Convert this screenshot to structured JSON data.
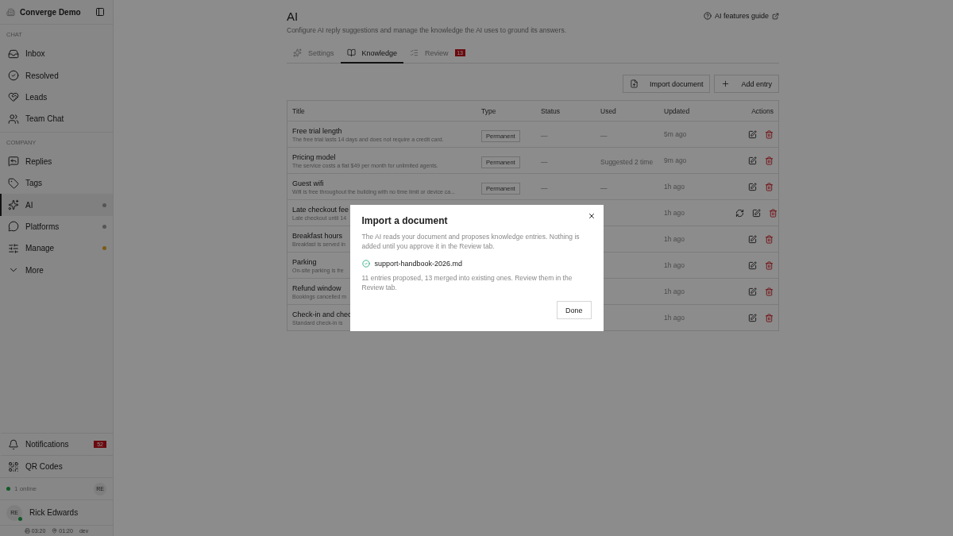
{
  "workspace": {
    "name": "Converge Demo"
  },
  "sidebar": {
    "sections": [
      {
        "heading": "CHAT",
        "items": [
          {
            "label": "Inbox",
            "selected": false
          },
          {
            "label": "Resolved",
            "selected": false
          },
          {
            "label": "Leads",
            "selected": false
          },
          {
            "label": "Team Chat",
            "selected": false
          }
        ]
      },
      {
        "heading": "COMPANY",
        "items": [
          {
            "label": "Replies",
            "selected": false
          },
          {
            "label": "Tags",
            "selected": false
          },
          {
            "label": "AI",
            "selected": true,
            "color": "#555555"
          },
          {
            "label": "Platforms",
            "selected": false,
            "color": "#555555"
          },
          {
            "label": "Manage",
            "selected": false,
            "color": "#7b5b15"
          },
          {
            "label": "More",
            "selected": false
          }
        ]
      }
    ],
    "bottom": [
      {
        "label": "Notifications",
        "badge": "52"
      },
      {
        "label": "QR Codes"
      }
    ],
    "presence": {
      "label": "1 online",
      "avatar": "RE"
    },
    "user": {
      "initials": "RE",
      "name": "Rick Edwards"
    },
    "footer": {
      "time_a": "03:20",
      "time_b": "01:20",
      "env": "dev"
    }
  },
  "page": {
    "title": "AI",
    "subtitle": "Configure AI reply suggestions and manage the knowledge the AI uses to ground its answers.",
    "guide_link": "AI features guide"
  },
  "tabs": [
    {
      "label": "Settings",
      "selected": false
    },
    {
      "label": "Knowledge",
      "selected": true
    },
    {
      "label": "Review",
      "selected": false,
      "badge": "13"
    }
  ],
  "actions": [
    {
      "label": "Import document"
    },
    {
      "label": "Add entry"
    }
  ],
  "table": {
    "columns": [
      "Title",
      "Type",
      "Status",
      "Used",
      "Updated",
      "Actions"
    ],
    "rows": [
      {
        "title": "Free trial length",
        "description": "The free trial lasts 14 days and does not require a credit card.",
        "type": "Permanent",
        "status": "—",
        "used": "—",
        "updated": "5m ago",
        "sync": false
      },
      {
        "title": "Pricing model",
        "description": "The service costs a flat $49 per month for unlimited agents.",
        "type": "Permanent",
        "status": "—",
        "used": "Suggested 2 time",
        "updated": "9m ago",
        "sync": false
      },
      {
        "title": "Guest wifi",
        "description": "Wifi is free throughout the building with no time limit or device ca...",
        "type": "Permanent",
        "status": "—",
        "used": "—",
        "updated": "1h ago",
        "sync": false
      },
      {
        "title": "Late checkout fee",
        "description": "Late checkout until 14",
        "updated": "1h ago",
        "sync": true
      },
      {
        "title": "Breakfast hours",
        "description": "Breakfast is served in",
        "updated": "1h ago",
        "sync": false
      },
      {
        "title": "Parking",
        "description": "On-site parking is fre",
        "updated": "1h ago",
        "sync": false
      },
      {
        "title": "Refund window",
        "description": "Bookings cancelled m",
        "updated": "1h ago",
        "sync": false
      },
      {
        "title": "Check-in and chec",
        "description": "Standard check-in is",
        "updated": "1h ago",
        "sync": false
      }
    ]
  },
  "dialog": {
    "title": "Import a document",
    "text": "The AI reads your document and proposes knowledge entries. Nothing is added until you approve it in the Review tab.",
    "file": "support-handbook-2026.md",
    "result": "11 entries proposed, 13 merged into existing ones. Review them in the Review tab.",
    "button": "Done"
  }
}
